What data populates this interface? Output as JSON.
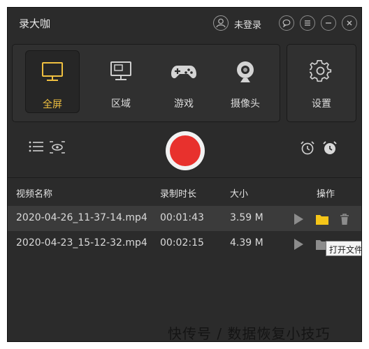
{
  "app": {
    "title": "录大咖"
  },
  "user": {
    "login_label": "未登录"
  },
  "modes": [
    {
      "label": "全屏",
      "icon": "monitor-icon",
      "selected": true
    },
    {
      "label": "区域",
      "icon": "region-monitor-icon"
    },
    {
      "label": "游戏",
      "icon": "gamepad-icon"
    },
    {
      "label": "摄像头",
      "icon": "webcam-icon"
    }
  ],
  "settings": {
    "label": "设置",
    "icon": "gear-icon"
  },
  "colors": {
    "accent": "#f0c040",
    "record": "#e8312d",
    "background": "#2b2b2b",
    "folder": "#f5c518"
  },
  "table": {
    "headers": {
      "name": "视频名称",
      "duration": "录制时长",
      "size": "大小",
      "actions": "操作"
    },
    "rows": [
      {
        "name": "2020-04-26_11-37-14.mp4",
        "duration": "00:01:43",
        "size": "3.59 M"
      },
      {
        "name": "2020-04-23_15-12-32.mp4",
        "duration": "00:02:15",
        "size": "4.39 M"
      }
    ]
  },
  "tooltip": {
    "text": "打开文件夹"
  },
  "watermark": {
    "text": "快传号 / 数据恢复小技巧"
  }
}
